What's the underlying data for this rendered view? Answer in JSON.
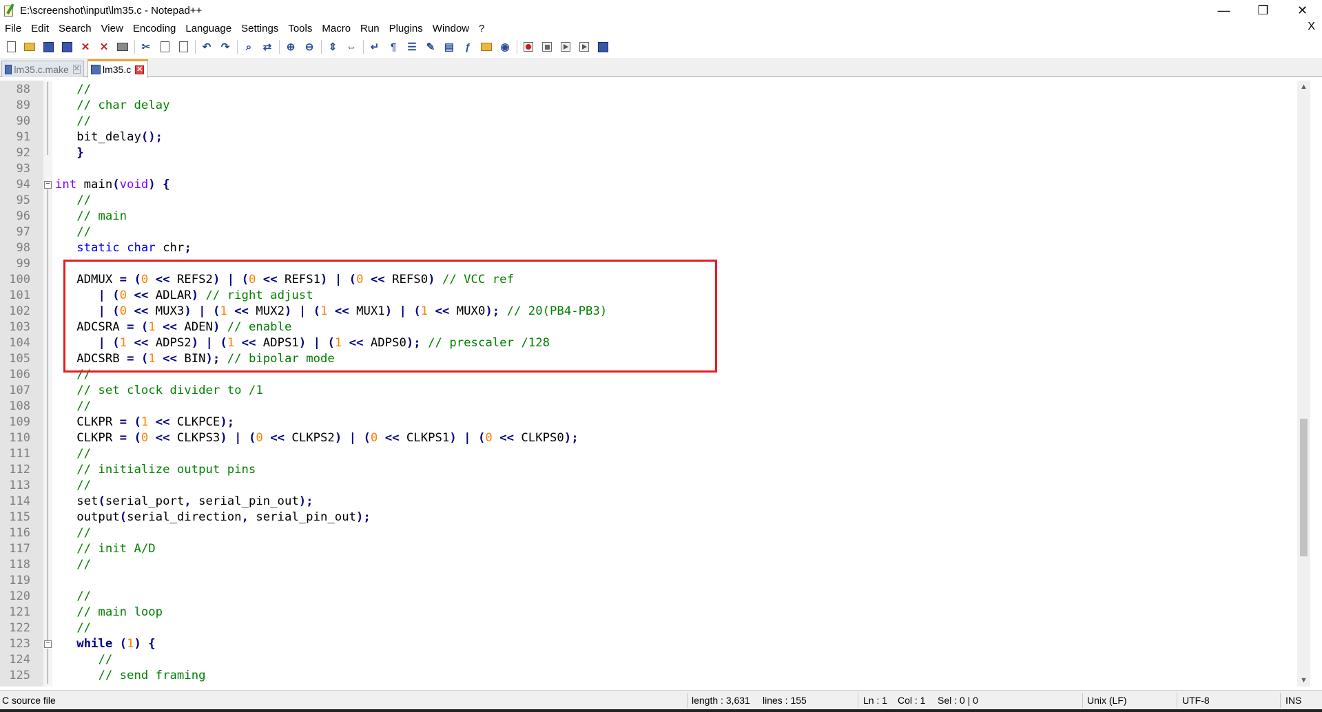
{
  "window": {
    "title": "E:\\screenshot\\input\\lm35.c - Notepad++",
    "minimize": "—",
    "restore": "❐",
    "close": "✕"
  },
  "menu": {
    "items": [
      "File",
      "Edit",
      "Search",
      "View",
      "Encoding",
      "Language",
      "Settings",
      "Tools",
      "Macro",
      "Run",
      "Plugins",
      "Window",
      "?"
    ],
    "close_doc": "X"
  },
  "tabs": [
    {
      "label": "lm35.c.make",
      "active": false,
      "close": "✕"
    },
    {
      "label": "lm35.c",
      "active": true,
      "close": "✕"
    }
  ],
  "editor": {
    "lines": [
      {
        "n": "88",
        "code": "   //"
      },
      {
        "n": "89",
        "code": "   // char delay"
      },
      {
        "n": "90",
        "code": "   //"
      },
      {
        "n": "91",
        "code": "   bit_delay();"
      },
      {
        "n": "92",
        "code": "   }"
      },
      {
        "n": "93",
        "code": ""
      },
      {
        "n": "94",
        "code": "int main(void) {"
      },
      {
        "n": "95",
        "code": "   //"
      },
      {
        "n": "96",
        "code": "   // main"
      },
      {
        "n": "97",
        "code": "   //"
      },
      {
        "n": "98",
        "code": "   static char chr;"
      },
      {
        "n": "99",
        "code": ""
      },
      {
        "n": "100",
        "code": "   ADMUX = (0 << REFS2) | (0 << REFS1) | (0 << REFS0) // VCC ref"
      },
      {
        "n": "101",
        "code": "      | (0 << ADLAR) // right adjust"
      },
      {
        "n": "102",
        "code": "      | (0 << MUX3) | (1 << MUX2) | (1 << MUX1) | (1 << MUX0); // 20(PB4-PB3)"
      },
      {
        "n": "103",
        "code": "   ADCSRA = (1 << ADEN) // enable"
      },
      {
        "n": "104",
        "code": "      | (1 << ADPS2) | (1 << ADPS1) | (1 << ADPS0); // prescaler /128"
      },
      {
        "n": "105",
        "code": "   ADCSRB = (1 << BIN); // bipolar mode"
      },
      {
        "n": "106",
        "code": "   //"
      },
      {
        "n": "107",
        "code": "   // set clock divider to /1"
      },
      {
        "n": "108",
        "code": "   //"
      },
      {
        "n": "109",
        "code": "   CLKPR = (1 << CLKPCE);"
      },
      {
        "n": "110",
        "code": "   CLKPR = (0 << CLKPS3) | (0 << CLKPS2) | (0 << CLKPS1) | (0 << CLKPS0);"
      },
      {
        "n": "111",
        "code": "   //"
      },
      {
        "n": "112",
        "code": "   // initialize output pins"
      },
      {
        "n": "113",
        "code": "   //"
      },
      {
        "n": "114",
        "code": "   set(serial_port, serial_pin_out);"
      },
      {
        "n": "115",
        "code": "   output(serial_direction, serial_pin_out);"
      },
      {
        "n": "116",
        "code": "   //"
      },
      {
        "n": "117",
        "code": "   // init A/D"
      },
      {
        "n": "118",
        "code": "   //"
      },
      {
        "n": "119",
        "code": ""
      },
      {
        "n": "120",
        "code": "   //"
      },
      {
        "n": "121",
        "code": "   // main loop"
      },
      {
        "n": "122",
        "code": "   //"
      },
      {
        "n": "123",
        "code": "   while (1) {"
      },
      {
        "n": "124",
        "code": "      //"
      },
      {
        "n": "125",
        "code": "      // send framing"
      }
    ],
    "highlight_color": "#e8191f"
  },
  "status": {
    "file_type": "C source file",
    "length": "length : 3,631",
    "lines": "lines : 155",
    "ln": "Ln : 1",
    "col": "Col : 1",
    "sel": "Sel : 0 | 0",
    "eol": "Unix (LF)",
    "encoding": "UTF-8",
    "mode": "INS"
  },
  "toolbar_icons": [
    "new-file-icon",
    "open-file-icon",
    "save-icon",
    "save-all-icon",
    "close-icon",
    "close-all-icon",
    "print-icon",
    "cut-icon",
    "copy-icon",
    "paste-icon",
    "undo-icon",
    "redo-icon",
    "find-icon",
    "replace-icon",
    "zoom-in-icon",
    "zoom-out-icon",
    "sync-vertical-icon",
    "sync-horizontal-icon",
    "word-wrap-icon",
    "show-all-chars-icon",
    "indent-guide-icon",
    "user-language-icon",
    "doc-map-icon",
    "function-list-icon",
    "folder-workspace-icon",
    "monitoring-icon",
    "record-macro-icon",
    "stop-record-icon",
    "play-macro-icon",
    "run-macro-multiple-icon",
    "save-macro-icon"
  ]
}
